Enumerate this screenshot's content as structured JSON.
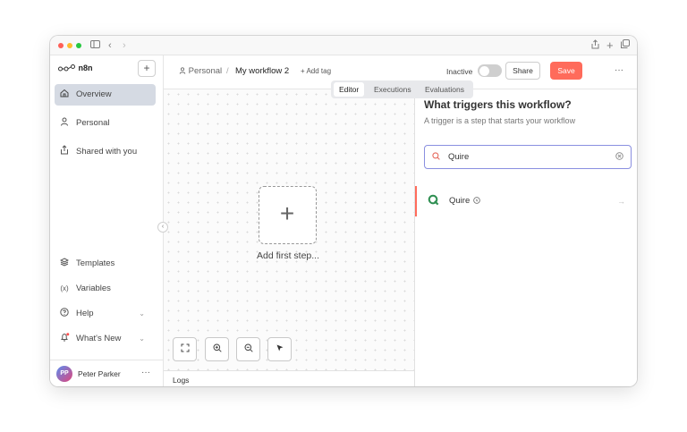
{
  "brand": {
    "name": "n8n",
    "accent": "#ff6b5b",
    "trigger_icon_color": "#2f8f52"
  },
  "titlebar": {
    "icons": [
      "sidebar-icon",
      "chevron-left-icon",
      "chevron-right-icon",
      "share-icon",
      "plus-icon",
      "copy-icon"
    ]
  },
  "sidebar": {
    "add_label": "+",
    "items": [
      {
        "label": "Overview",
        "icon": "home-icon",
        "active": true
      },
      {
        "label": "Personal",
        "icon": "user-icon"
      },
      {
        "label": "Shared with you",
        "icon": "share-icon"
      }
    ],
    "bottom_items": [
      {
        "label": "Templates",
        "icon": "templates-icon"
      },
      {
        "label": "Variables",
        "icon": "variables-icon"
      },
      {
        "label": "Help",
        "icon": "help-icon",
        "has_chevron": true
      },
      {
        "label": "What's New",
        "icon": "bell-icon",
        "has_chevron": true,
        "notification_dot": true
      }
    ],
    "user": {
      "initials": "PP",
      "name": "Peter Parker",
      "more": "···"
    }
  },
  "header": {
    "breadcrumb_project": "Personal",
    "breadcrumb_sep": "/",
    "workflow_name": "My workflow 2",
    "add_tag": "+ Add tag",
    "status_label": "Inactive",
    "active": false,
    "share_label": "Share",
    "save_label": "Save",
    "more": "···"
  },
  "tabs": [
    {
      "label": "Editor",
      "active": true
    },
    {
      "label": "Executions"
    },
    {
      "label": "Evaluations"
    }
  ],
  "canvas": {
    "add_first_step_label": "Add first step...",
    "controls": [
      "fit-view-icon",
      "zoom-in-icon",
      "zoom-out-icon",
      "clean-up-icon"
    ]
  },
  "logs": {
    "label": "Logs"
  },
  "trigger_panel": {
    "title": "What triggers this workflow?",
    "subtitle": "A trigger is a step that starts your workflow",
    "search_value": "Quire",
    "results": [
      {
        "name": "Quire",
        "icon": "quire-icon",
        "badge": "trigger-badge-icon"
      }
    ]
  }
}
